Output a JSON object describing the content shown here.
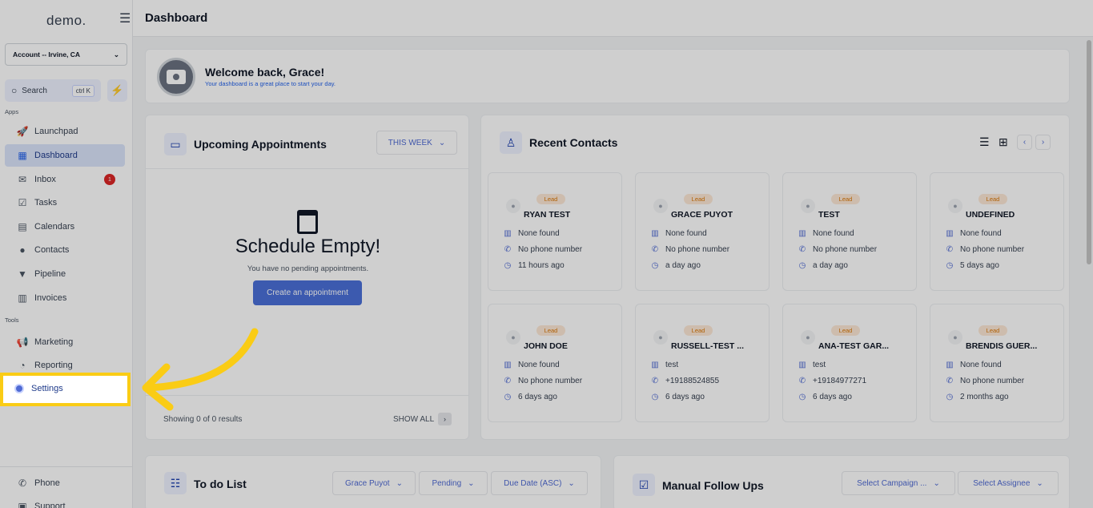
{
  "sidebar": {
    "brand": "demo.",
    "account": "Account -- Irvine, CA",
    "search": {
      "label": "Search",
      "shortcut": "ctrl K"
    },
    "section_apps": "Apps",
    "section_tools": "Tools",
    "items": [
      {
        "label": "Launchpad",
        "icon": "rocket-icon"
      },
      {
        "label": "Dashboard",
        "icon": "dashboard-icon"
      },
      {
        "label": "Inbox",
        "icon": "inbox-icon",
        "badge": "1"
      },
      {
        "label": "Tasks",
        "icon": "tasks-icon"
      },
      {
        "label": "Calendars",
        "icon": "calendar-icon"
      },
      {
        "label": "Contacts",
        "icon": "contacts-icon"
      },
      {
        "label": "Pipeline",
        "icon": "pipeline-icon"
      },
      {
        "label": "Invoices",
        "icon": "invoice-icon"
      }
    ],
    "tools": [
      {
        "label": "Marketing",
        "icon": "megaphone-icon"
      },
      {
        "label": "Reporting",
        "icon": "chart-icon"
      },
      {
        "label": "Settings",
        "icon": "gear-icon"
      }
    ],
    "bottom": [
      {
        "label": "Phone",
        "icon": "phone-icon"
      },
      {
        "label": "Support",
        "icon": "support-icon"
      }
    ]
  },
  "header": {
    "title": "Dashboard"
  },
  "welcome": {
    "title": "Welcome back, Grace!",
    "subtitle": "Your dashboard is a great place to start your day."
  },
  "appointments": {
    "title": "Upcoming Appointments",
    "filter": "THIS WEEK",
    "empty_title": "Schedule Empty!",
    "empty_subtitle": "You have no pending appointments.",
    "create_button": "Create an appointment",
    "results": "Showing 0 of 0 results",
    "show_all": "SHOW ALL"
  },
  "recent_contacts": {
    "title": "Recent Contacts",
    "contacts": [
      {
        "tag": "Lead",
        "name": "RYAN TEST",
        "company": "None found",
        "phone": "No phone number",
        "time": "11 hours ago"
      },
      {
        "tag": "Lead",
        "name": "GRACE PUYOT",
        "company": "None found",
        "phone": "No phone number",
        "time": "a day ago"
      },
      {
        "tag": "Lead",
        "name": "TEST",
        "company": "None found",
        "phone": "No phone number",
        "time": "a day ago"
      },
      {
        "tag": "Lead",
        "name": "UNDEFINED",
        "company": "None found",
        "phone": "No phone number",
        "time": "5 days ago"
      },
      {
        "tag": "Lead",
        "name": "JOHN DOE",
        "company": "None found",
        "phone": "No phone number",
        "time": "6 days ago"
      },
      {
        "tag": "Lead",
        "name": "RUSSELL-TEST ...",
        "company": "test",
        "phone": "+19188524855",
        "time": "6 days ago"
      },
      {
        "tag": "Lead",
        "name": "ANA-TEST GAR...",
        "company": "test",
        "phone": "+19184977271",
        "time": "6 days ago"
      },
      {
        "tag": "Lead",
        "name": "BRENDIS GUER...",
        "company": "None found",
        "phone": "No phone number",
        "time": "2 months ago"
      }
    ]
  },
  "todo": {
    "title": "To do List",
    "filters": [
      "Grace Puyot",
      "Pending",
      "Due Date (ASC)"
    ]
  },
  "followups": {
    "title": "Manual Follow Ups",
    "filters": [
      "Select Campaign ...",
      "Select Assignee"
    ]
  },
  "colors": {
    "accent": "#4a6fd8",
    "highlight": "#facc15",
    "lead_badge": "#fde8d6"
  }
}
